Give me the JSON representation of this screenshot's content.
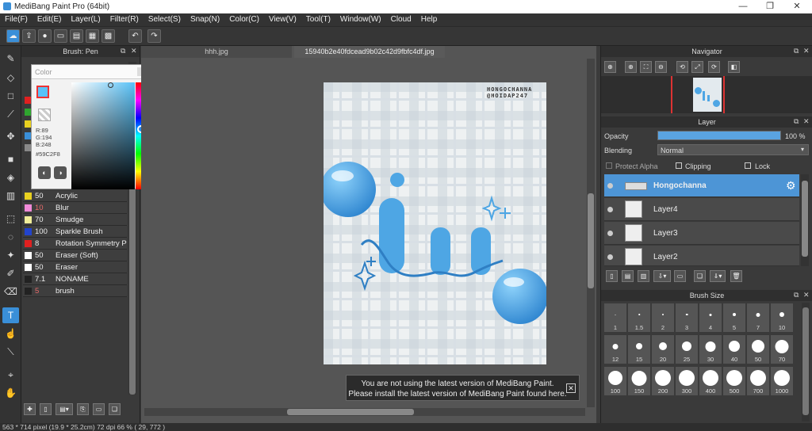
{
  "window": {
    "title": "MediBang Paint Pro (64bit)",
    "min": "—",
    "max": "❐",
    "close": "✕"
  },
  "menu": [
    "File(F)",
    "Edit(E)",
    "Layer(L)",
    "Filter(R)",
    "Select(S)",
    "Snap(N)",
    "Color(C)",
    "View(V)",
    "Tool(T)",
    "Window(W)",
    "Cloud",
    "Help"
  ],
  "brush_panel": {
    "title": "Brush: Pen",
    "rows": [
      {
        "size": "50",
        "name": "Acrylic",
        "color": "#e8d020",
        "size_color": "#eeeeee"
      },
      {
        "size": "10",
        "name": "Blur",
        "color": "#f08ad8",
        "size_color": "#e86a6a"
      },
      {
        "size": "70",
        "name": "Smudge",
        "color": "#f1ef9a",
        "size_color": "#eeeeee"
      },
      {
        "size": "100",
        "name": "Sparkle Brush",
        "color": "#2244cc",
        "size_color": "#eeeeee"
      },
      {
        "size": "8",
        "name": "Rotation Symmetry Pe",
        "color": "#e02020",
        "size_color": "#eeeeee"
      },
      {
        "size": "50",
        "name": "Eraser (Soft)",
        "color": "#ffffff",
        "size_color": "#eeeeee"
      },
      {
        "size": "50",
        "name": "Eraser",
        "color": "#ffffff",
        "size_color": "#eeeeee"
      },
      {
        "size": "7.1",
        "name": "NONAME",
        "color": "#222222",
        "size_color": "#eeeeee"
      },
      {
        "size": "5",
        "name": "brush",
        "color": "#222222",
        "size_color": "#e86a6a"
      }
    ]
  },
  "color_popup": {
    "title": "Color",
    "r": "R:89",
    "g": "G:194",
    "b": "B:248",
    "hex": "#59C2F8",
    "current": "#59c2f8"
  },
  "tabs": {
    "tab1": "hhh.jpg",
    "tab2": "15940b2e40fdcead9b02c42d9fbfc4df.jpg"
  },
  "artwork": {
    "text1": "HONGOCHANNA",
    "text2": "@HOIDAP247",
    "accent": "#4ea6e4"
  },
  "notice": {
    "line1": "You are not using the latest version of MediBang Paint.",
    "line2": "Please install the latest version of MediBang Paint found here.",
    "close": "✕"
  },
  "navigator": {
    "title": "Navigator"
  },
  "layer_panel": {
    "title": "Layer",
    "opacity_label": "Opacity",
    "opacity_value": "100 %",
    "opacity": 1.0,
    "blending_label": "Blending",
    "blending_value": "Normal",
    "protect_alpha": "Protect Alpha",
    "clipping": "Clipping",
    "lock": "Lock",
    "layers": [
      "Hongochanna",
      "Layer4",
      "Layer3",
      "Layer2"
    ]
  },
  "brush_size": {
    "title": "Brush Size",
    "sizes": [
      "1",
      "1.5",
      "2",
      "3",
      "4",
      "5",
      "7",
      "10",
      "12",
      "15",
      "20",
      "25",
      "30",
      "40",
      "50",
      "70",
      "100",
      "150",
      "200",
      "300",
      "400",
      "500",
      "700",
      "1000"
    ]
  },
  "status": {
    "text": "563 * 714 pixel   (19.9 * 25.2cm)   72 dpi   66 %   ( 29, 772 )"
  }
}
